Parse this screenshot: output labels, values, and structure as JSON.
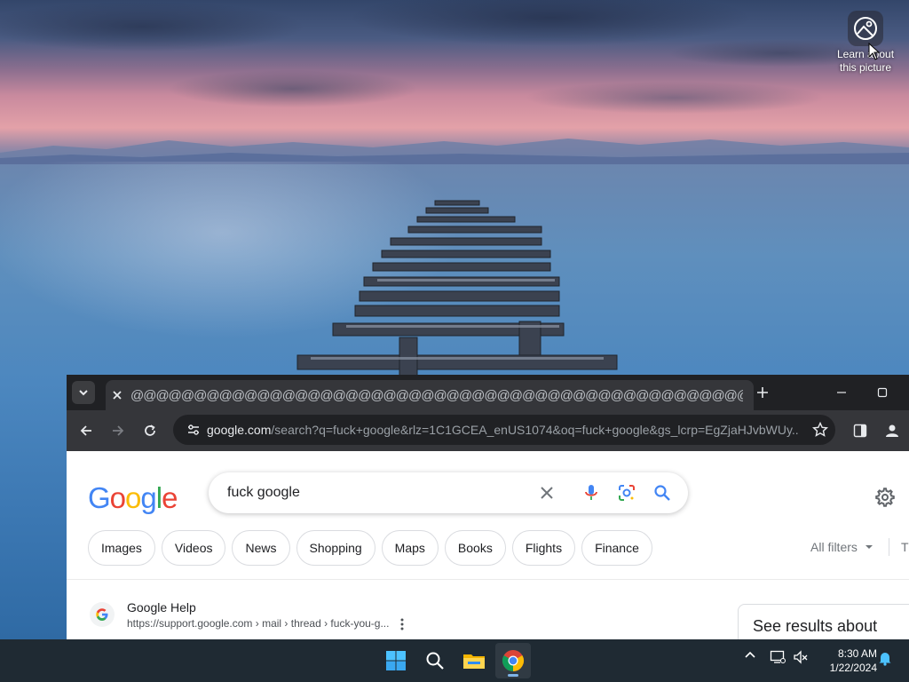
{
  "desktop": {
    "learn_label": "Learn about this picture"
  },
  "browser": {
    "tab_title": "@@@@@@@@@@@@@@@@@@@@@@@@@@@@@@@@@@@@@@@@@@@@@@@@@@@@@@@@@@@@@@@@@@",
    "url_host": "google.com",
    "url_rest": "/search?q=fuck+google&rlz=1C1GCEA_enUS1074&oq=fuck+google&gs_lcrp=EgZjaHJvbWUy..."
  },
  "google": {
    "logo": [
      "G",
      "o",
      "o",
      "g",
      "l",
      "e"
    ],
    "logo_colors": [
      "#4285f4",
      "#ea4335",
      "#fbbc05",
      "#4285f4",
      "#34a853",
      "#ea4335"
    ],
    "query": "fuck google",
    "chips": [
      "Images",
      "Videos",
      "News",
      "Shopping",
      "Maps",
      "Books",
      "Flights",
      "Finance"
    ],
    "all_filters": "All filters",
    "tools_partial": "T",
    "result": {
      "site_name": "Google Help",
      "site_url": "https://support.google.com › mail › thread › fuck-you-g..."
    },
    "see_results_about": "See results about"
  },
  "taskbar": {
    "time": "8:30 AM",
    "date": "1/22/2024",
    "apps": [
      "start-icon",
      "search-icon",
      "file-explorer-icon",
      "chrome-icon"
    ]
  }
}
